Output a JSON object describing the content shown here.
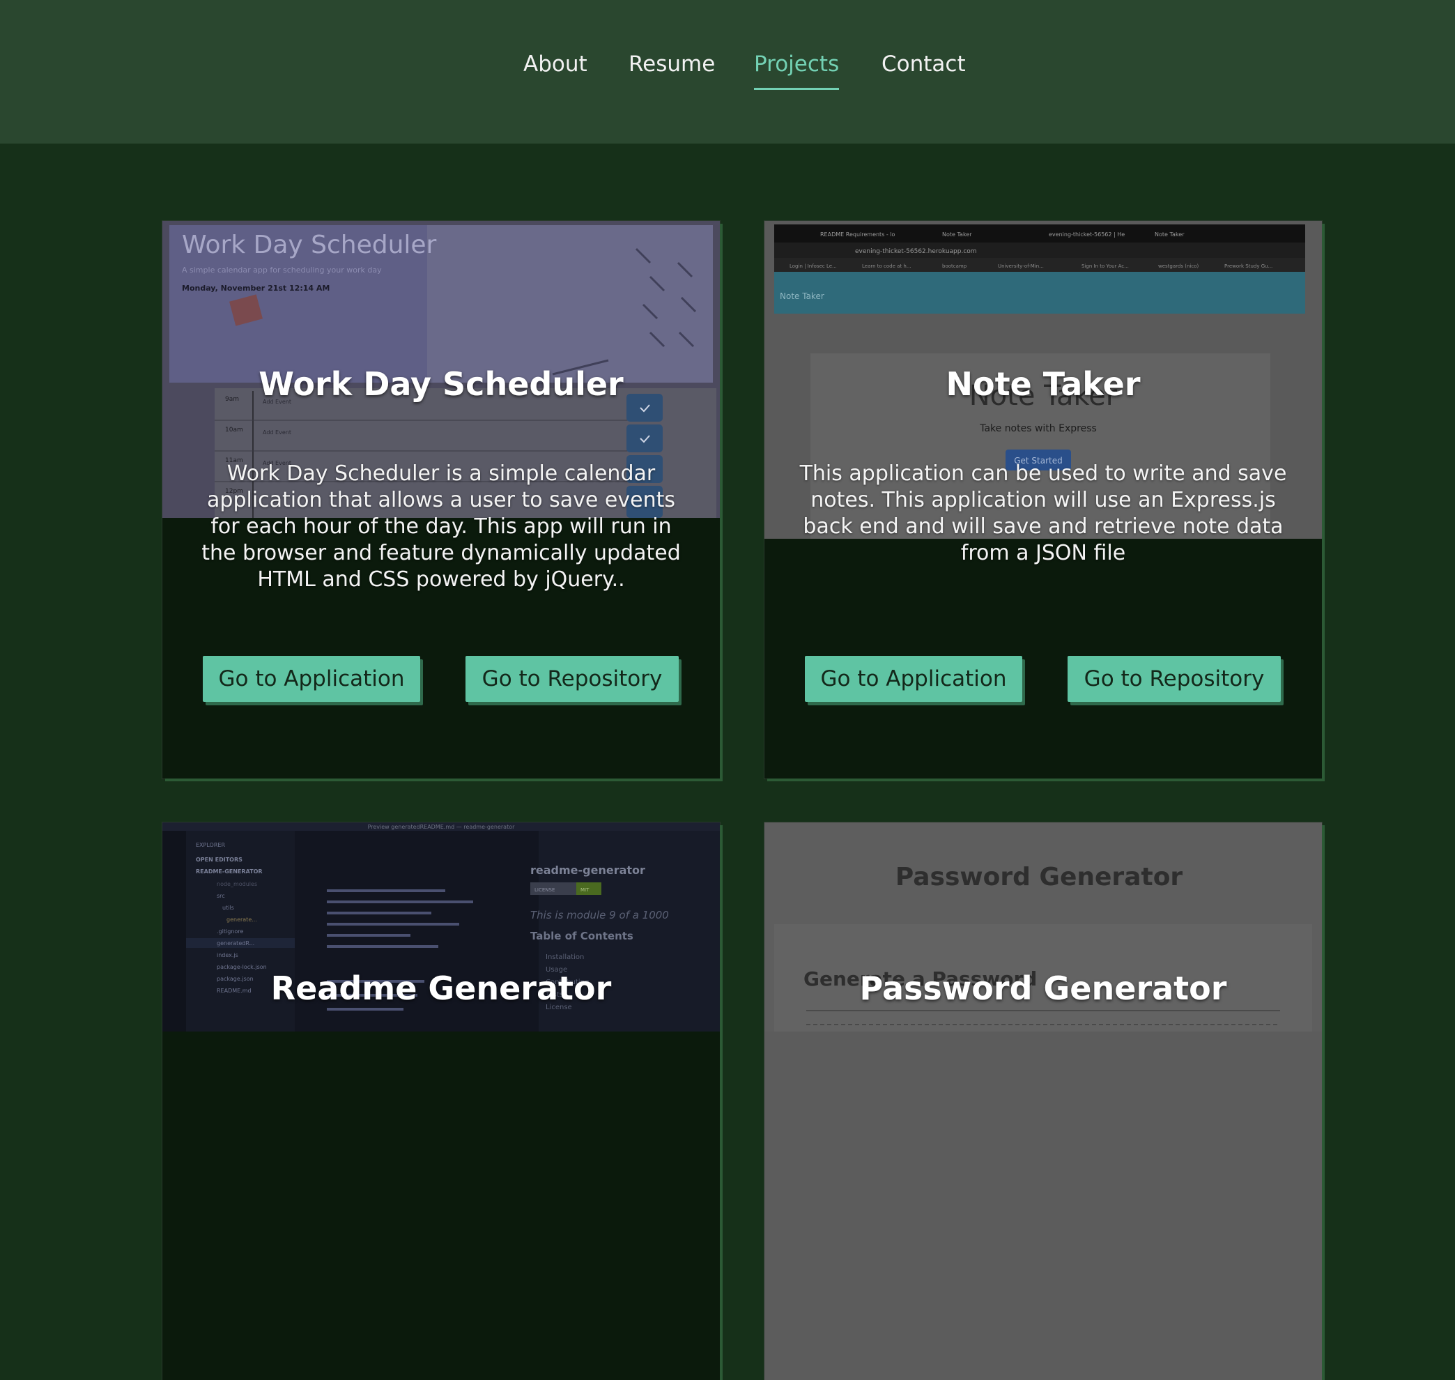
{
  "nav": {
    "items": [
      {
        "label": "About",
        "active": false
      },
      {
        "label": "Resume",
        "active": false
      },
      {
        "label": "Projects",
        "active": true
      },
      {
        "label": "Contact",
        "active": false
      }
    ]
  },
  "projects": [
    {
      "title": "Work Day Scheduler",
      "description": "Work Day Scheduler is a simple calendar application that allows a user to save events for each hour of the day. This app will run in the browser and feature dynamically updated HTML and CSS powered by jQuery..",
      "app_button": "Go to Application",
      "repo_button": "Go to Repository",
      "preview": {
        "heading": "Work Day Scheduler",
        "subheading": "A simple calendar app for scheduling your work day",
        "date": "Monday, November 21st 12:14 AM",
        "hours": [
          "9am",
          "10am",
          "11am",
          "12pm"
        ],
        "placeholder": "Add Event"
      }
    },
    {
      "title": "Note Taker",
      "description": "This application can be used to write and save notes. This application will use an Express.js back end and will save and retrieve note data from a JSON file",
      "app_button": "Go to Application",
      "repo_button": "Go to Repository",
      "preview": {
        "tabs": [
          "README Requirements - lo",
          "Note Taker",
          "evening-thicket-56562 | He",
          "Note Taker"
        ],
        "url": "evening-thicket-56562.herokuapp.com",
        "bookmarks": [
          "Login | Infosec Le...",
          "Learn to code at h...",
          "bootcamp",
          "University-of-Min...",
          "Sign In to Your Ac...",
          "westgards (nico)",
          "Prework Study Gu..."
        ],
        "navbar": "Note Taker",
        "hero_title": "Note Taker",
        "hero_sub": "Take notes with Express",
        "hero_button": "Get Started"
      }
    },
    {
      "title": "Readme Generator",
      "preview": {
        "window_title": "Preview generatedREADME.md — readme-generator",
        "explorer": "EXPLORER",
        "open_editors": "OPEN EDITORS",
        "folder": "README-GENERATOR",
        "files": [
          "node_modules",
          "src",
          "utils",
          "generate...",
          ".gitignore",
          "generatedR...",
          "index.js",
          "package-lock.json",
          "package.json",
          "README.md"
        ],
        "preview_title": "readme-generator",
        "badge_left": "LICENSE",
        "badge_right": "MIT",
        "italic": "This is module 9 of a 1000",
        "toc": "Table of Contents",
        "toc_items": [
          "Installation",
          "Usage",
          "Contributing",
          "Tests",
          "License"
        ]
      }
    },
    {
      "title": "Password Generator",
      "preview": {
        "heading": "Password Generator",
        "subheading": "Generate a Password"
      }
    }
  ]
}
